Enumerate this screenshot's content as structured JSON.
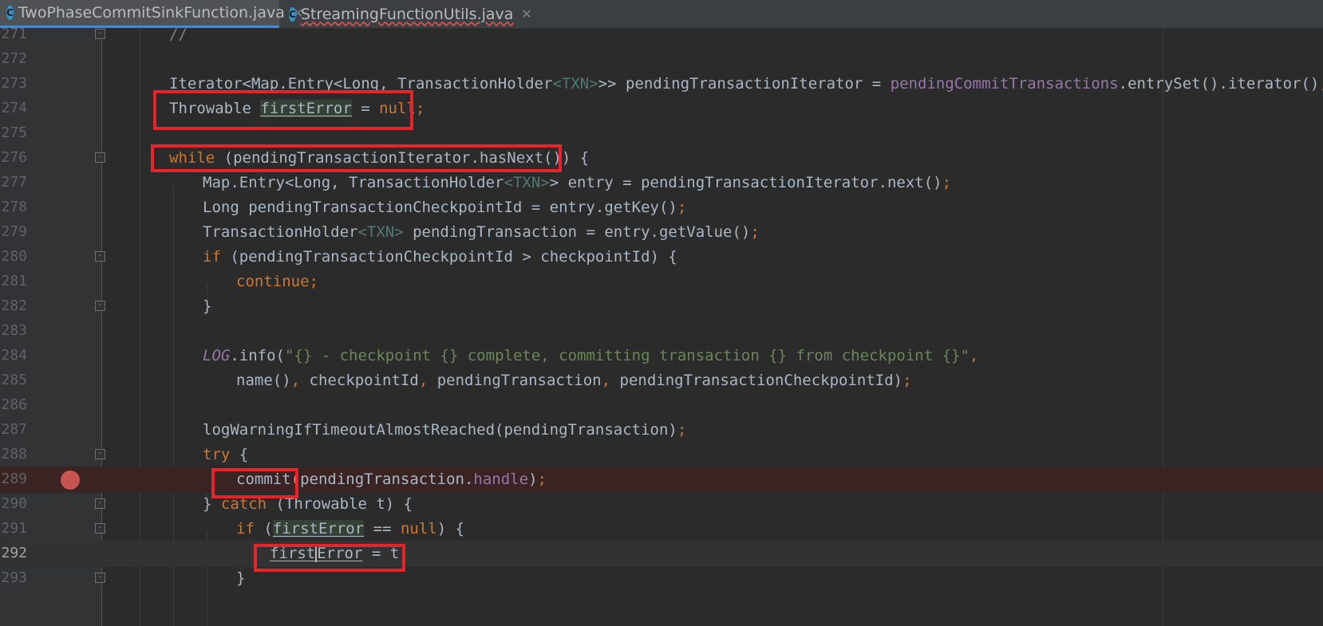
{
  "tabs": [
    {
      "label": "TwoPhaseCommitSinkFunction.java",
      "icon": "C",
      "active": true
    },
    {
      "label": "StreamingFunctionUtils.java",
      "icon": "C",
      "active": false
    }
  ],
  "line_numbers": [
    "271",
    "272",
    "273",
    "274",
    "275",
    "276",
    "277",
    "278",
    "279",
    "280",
    "281",
    "282",
    "283",
    "284",
    "285",
    "286",
    "287",
    "288",
    "289",
    "290",
    "291",
    "292",
    "293"
  ],
  "code": {
    "l271_comment": "//",
    "l273_a": "Iterator<Map.Entry<Long, TransactionHolder",
    "l273_tp": "<TXN>",
    "l273_b": ">> pendingTransactionIterator = ",
    "l273_field": "pendingCommitTransactions",
    "l273_c": ".entrySet().iterator()",
    "l274_type": "Throwable ",
    "l274_var": "firstError",
    "l274_eq": " = ",
    "l274_null": "null",
    "l276_kw": "while",
    "l276_rest": " (pendingTransactionIterator.hasNext()) {",
    "l277_a": "Map.Entry<Long, TransactionHolder",
    "l277_tp": "<TXN>",
    "l277_b": "> entry = pendingTransactionIterator.next()",
    "l278": "Long pendingTransactionCheckpointId = entry.getKey()",
    "l279_a": "TransactionHolder",
    "l279_tp": "<TXN>",
    "l279_b": " pendingTransaction = entry.getValue()",
    "l280_kw": "if",
    "l280_rest": " (pendingTransactionCheckpointId > checkpointId) {",
    "l281_kw": "continue",
    "l282": "}",
    "l284_log": "LOG",
    "l284_a": ".info(",
    "l284_str": "\"{} - checkpoint {} complete, committing transaction {} from checkpoint {}\"",
    "l285_a": "name()",
    "l285_b": " checkpointId",
    "l285_c": " pendingTransaction",
    "l285_d": " pendingTransactionCheckpointId)",
    "l287": "logWarningIfTimeoutAlmostReached(pendingTransaction)",
    "l288_kw": "try",
    "l288_rest": " {",
    "l289_a": "commit(pendingTransaction.",
    "l289_field": "handle",
    "l289_b": ")",
    "l290_a": "} ",
    "l290_kw": "catch",
    "l290_b": " (Throwable t) {",
    "l291_kw": "if",
    "l291_a": " (",
    "l291_var": "firstError",
    "l291_b": " == ",
    "l291_null": "null",
    "l291_c": ") {",
    "l292_var1": "first",
    "l292_var2": "Error",
    "l292_b": " = t",
    "l293": "}",
    "semicolon": ";",
    "comma": ","
  },
  "breakpoint_line": "289",
  "current_line": "292",
  "colors": {
    "background": "#2b2b2b",
    "gutter": "#313335",
    "keyword": "#cc7832",
    "string": "#6a8759",
    "field": "#9876aa",
    "highlight_box": "#e8242a",
    "breakpoint": "#c75450"
  }
}
